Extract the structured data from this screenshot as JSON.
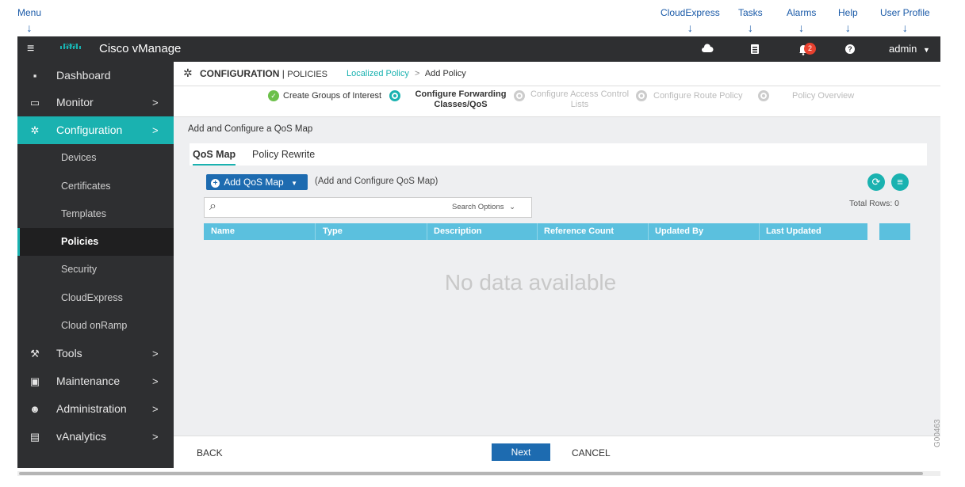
{
  "callouts": {
    "menu": "Menu",
    "cloudexpress": "CloudExpress",
    "tasks": "Tasks",
    "alarms": "Alarms",
    "help": "Help",
    "user_profile": "User Profile"
  },
  "topbar": {
    "logo_text": "cisco",
    "app_title": "Cisco vManage",
    "alarm_count": "2",
    "user": "admin"
  },
  "sidebar": {
    "items": [
      {
        "label": "Dashboard",
        "icon": "dashboard-icon"
      },
      {
        "label": "Monitor",
        "icon": "monitor-icon"
      },
      {
        "label": "Configuration",
        "icon": "gear-icon"
      },
      {
        "label": "Tools",
        "icon": "wrench-icon"
      },
      {
        "label": "Maintenance",
        "icon": "toolbox-icon"
      },
      {
        "label": "Administration",
        "icon": "users-icon"
      },
      {
        "label": "vAnalytics",
        "icon": "analytics-icon"
      }
    ],
    "sub_items": [
      "Devices",
      "Certificates",
      "Templates",
      "Policies",
      "Security",
      "CloudExpress",
      "Cloud onRamp"
    ],
    "active_item": "Configuration",
    "active_sub": "Policies"
  },
  "header": {
    "section": "CONFIGURATION",
    "separator": "|",
    "subsection": "POLICIES",
    "crumb_link": "Localized Policy",
    "crumb_sep": ">",
    "crumb_current": "Add Policy"
  },
  "steps": [
    {
      "label": "Create Groups of Interest",
      "state": "done"
    },
    {
      "label": "Configure Forwarding Classes/QoS",
      "state": "current"
    },
    {
      "label": "Configure Access Control Lists",
      "state": "pending"
    },
    {
      "label": "Configure Route Policy",
      "state": "pending"
    },
    {
      "label": "Policy Overview",
      "state": "pending"
    }
  ],
  "content": {
    "title": "Add and Configure a QoS Map",
    "tabs": [
      "QoS Map",
      "Policy Rewrite"
    ],
    "active_tab": "QoS Map",
    "add_button": "Add QoS Map",
    "add_hint": "(Add and Configure QoS Map)",
    "search_placeholder": "",
    "search_options": "Search Options",
    "total_rows": "Total Rows: 0",
    "columns": [
      "Name",
      "Type",
      "Description",
      "Reference Count",
      "Updated By",
      "Last Updated"
    ],
    "empty_text": "No data available"
  },
  "footer": {
    "back": "BACK",
    "next": "Next",
    "cancel": "CANCEL"
  },
  "figure_id": "G00463",
  "colors": {
    "accent": "#1ab2b0",
    "topbar": "#2e2f31",
    "primary_button": "#1d6bb0",
    "table_header": "#5bc0de",
    "alarm_badge": "#e8412f",
    "callout": "#1a5aa8"
  }
}
